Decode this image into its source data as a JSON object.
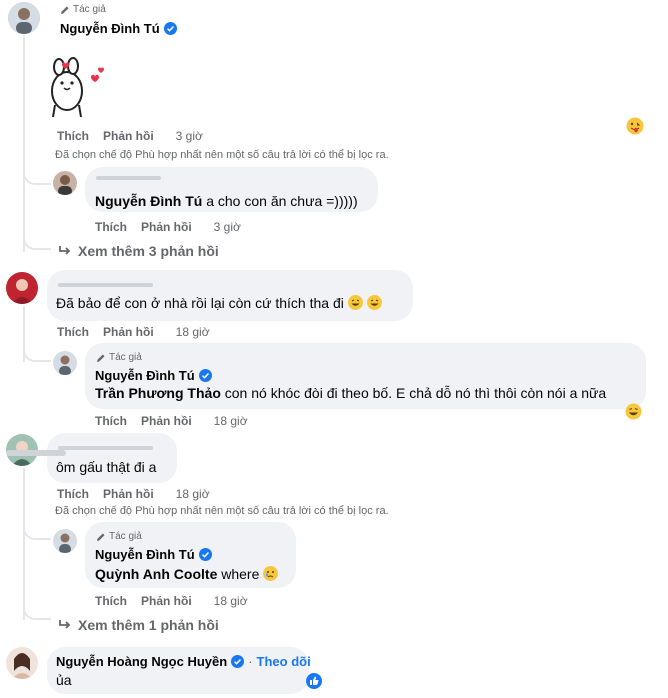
{
  "comments": [
    {
      "author_tag": "Tác giả",
      "name": "Nguyễn Đình Tú",
      "actions": {
        "like": "Thích",
        "reply": "Phản hồi",
        "time": "3 giờ"
      },
      "notice": "Đã chọn chế độ Phù hợp nhất nên một số câu trả lời có thể bị lọc ra.",
      "reply": {
        "mention": "Nguyễn Đình Tú",
        "text": " a cho con ăn chưa =)))))",
        "actions": {
          "like": "Thích",
          "reply": "Phản hồi",
          "time": "3 giờ"
        }
      },
      "more_replies": "Xem thêm 3 phản hồi"
    },
    {
      "text": "Đã bảo để con ở nhà rồi lại còn cứ thích tha đi",
      "actions": {
        "like": "Thích",
        "reply": "Phản hồi",
        "time": "18 giờ"
      },
      "reply": {
        "author_tag": "Tác giả",
        "name": "Nguyễn Đình Tú",
        "mention": "Trần Phương Thảo",
        "text": " con nó khóc đòi đi theo bố. E chả dỗ nó thì thôi còn nói a nữa",
        "actions": {
          "like": "Thích",
          "reply": "Phản hồi",
          "time": "18 giờ"
        }
      }
    },
    {
      "text": "ôm gấu thật đi a",
      "actions": {
        "like": "Thích",
        "reply": "Phản hồi",
        "time": "18 giờ"
      },
      "notice": "Đã chọn chế độ Phù hợp nhất nên một số câu trả lời có thể bị lọc ra.",
      "reply": {
        "author_tag": "Tác giả",
        "name": "Nguyễn Đình Tú",
        "mention": "Quỳnh Anh Coolte",
        "text": " where",
        "actions": {
          "like": "Thích",
          "reply": "Phản hồi",
          "time": "18 giờ"
        }
      },
      "more_replies": "Xem thêm 1 phản hồi"
    },
    {
      "name": "Nguyễn Hoàng Ngọc Huyền",
      "follow": "Theo dõi",
      "text": "ủa"
    }
  ],
  "colors": {
    "accent": "#1877f2",
    "bubble": "#f0f2f5",
    "meta": "#65676b"
  },
  "icons": [
    "pencil-icon",
    "verified-badge-icon",
    "reply-arrow-icon",
    "laughing-emoji-icon",
    "crying-emoji-icon",
    "like-reaction-icon",
    "tongue-emoji-reaction-icon"
  ]
}
